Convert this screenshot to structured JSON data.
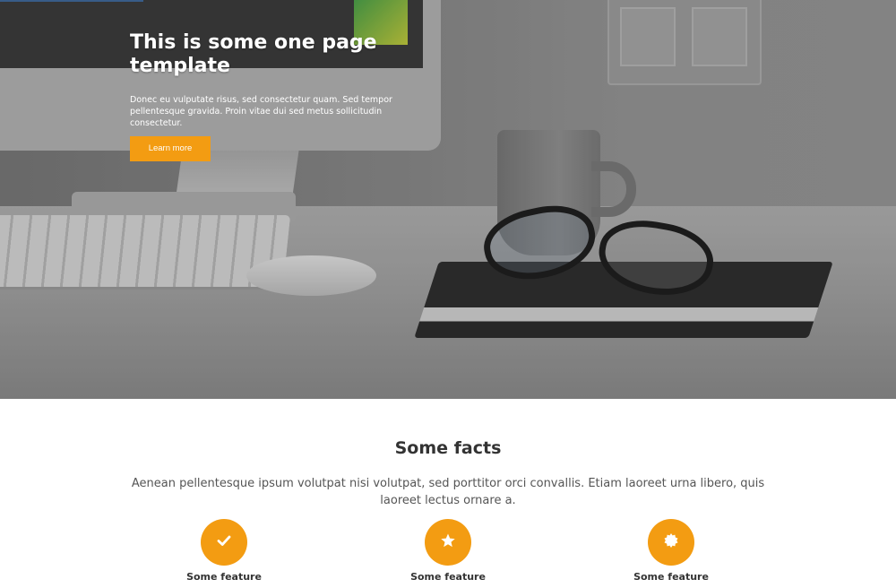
{
  "hero": {
    "title": "This is some one page template",
    "text": "Donec eu vulputate risus, sed consectetur quam. Sed tempor pellentesque gravida. Proin vitae dui sed metus sollicitudin consectetur.",
    "button_label": "Learn more",
    "accent_color": "#f39c12"
  },
  "facts": {
    "title": "Some facts",
    "text": "Aenean pellentesque ipsum volutpat nisi volutpat, sed porttitor orci convallis. Etiam laoreet urna libero, quis laoreet lectus ornare a.",
    "features": [
      {
        "icon": "checkmark-icon",
        "label": "Some feature"
      },
      {
        "icon": "star-icon",
        "label": "Some feature"
      },
      {
        "icon": "badge-icon",
        "label": "Some feature"
      }
    ]
  }
}
